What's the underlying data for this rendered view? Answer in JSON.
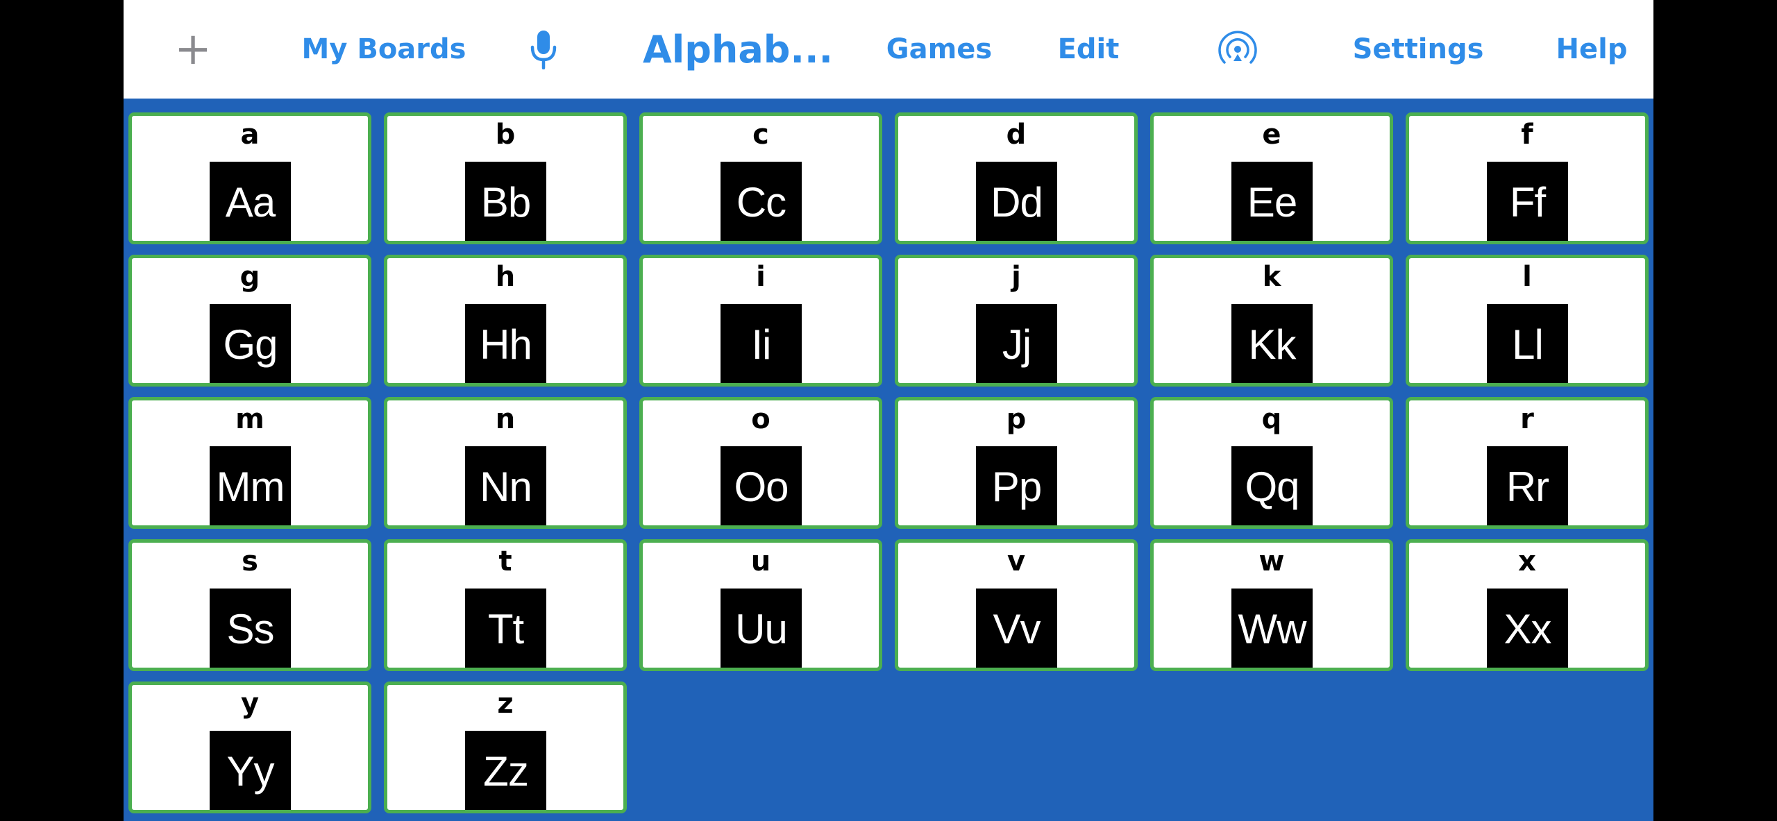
{
  "topbar": {
    "add_symbol": "+",
    "my_boards": "My Boards",
    "board_title": "Alphab...",
    "games": "Games",
    "edit": "Edit",
    "settings": "Settings",
    "help": "Help",
    "icons": {
      "add": "plus-icon",
      "voice": "microphone-icon",
      "broadcast": "airdrop-icon"
    }
  },
  "colors": {
    "accent": "#2f8ce8",
    "board_background": "#2062b8",
    "tile_border": "#4caf50",
    "tile_background": "#ffffff",
    "tile_image": "#000000"
  },
  "tiles": [
    {
      "label": "a",
      "image_text": "Aa"
    },
    {
      "label": "b",
      "image_text": "Bb"
    },
    {
      "label": "c",
      "image_text": "Cc"
    },
    {
      "label": "d",
      "image_text": "Dd"
    },
    {
      "label": "e",
      "image_text": "Ee"
    },
    {
      "label": "f",
      "image_text": "Ff"
    },
    {
      "label": "g",
      "image_text": "Gg"
    },
    {
      "label": "h",
      "image_text": "Hh"
    },
    {
      "label": "i",
      "image_text": "Ii"
    },
    {
      "label": "j",
      "image_text": "Jj"
    },
    {
      "label": "k",
      "image_text": "Kk"
    },
    {
      "label": "l",
      "image_text": "Ll"
    },
    {
      "label": "m",
      "image_text": "Mm"
    },
    {
      "label": "n",
      "image_text": "Nn"
    },
    {
      "label": "o",
      "image_text": "Oo"
    },
    {
      "label": "p",
      "image_text": "Pp"
    },
    {
      "label": "q",
      "image_text": "Qq"
    },
    {
      "label": "r",
      "image_text": "Rr"
    },
    {
      "label": "s",
      "image_text": "Ss"
    },
    {
      "label": "t",
      "image_text": "Tt"
    },
    {
      "label": "u",
      "image_text": "Uu"
    },
    {
      "label": "v",
      "image_text": "Vv"
    },
    {
      "label": "w",
      "image_text": "Ww"
    },
    {
      "label": "x",
      "image_text": "Xx"
    },
    {
      "label": "y",
      "image_text": "Yy"
    },
    {
      "label": "z",
      "image_text": "Zz"
    }
  ]
}
